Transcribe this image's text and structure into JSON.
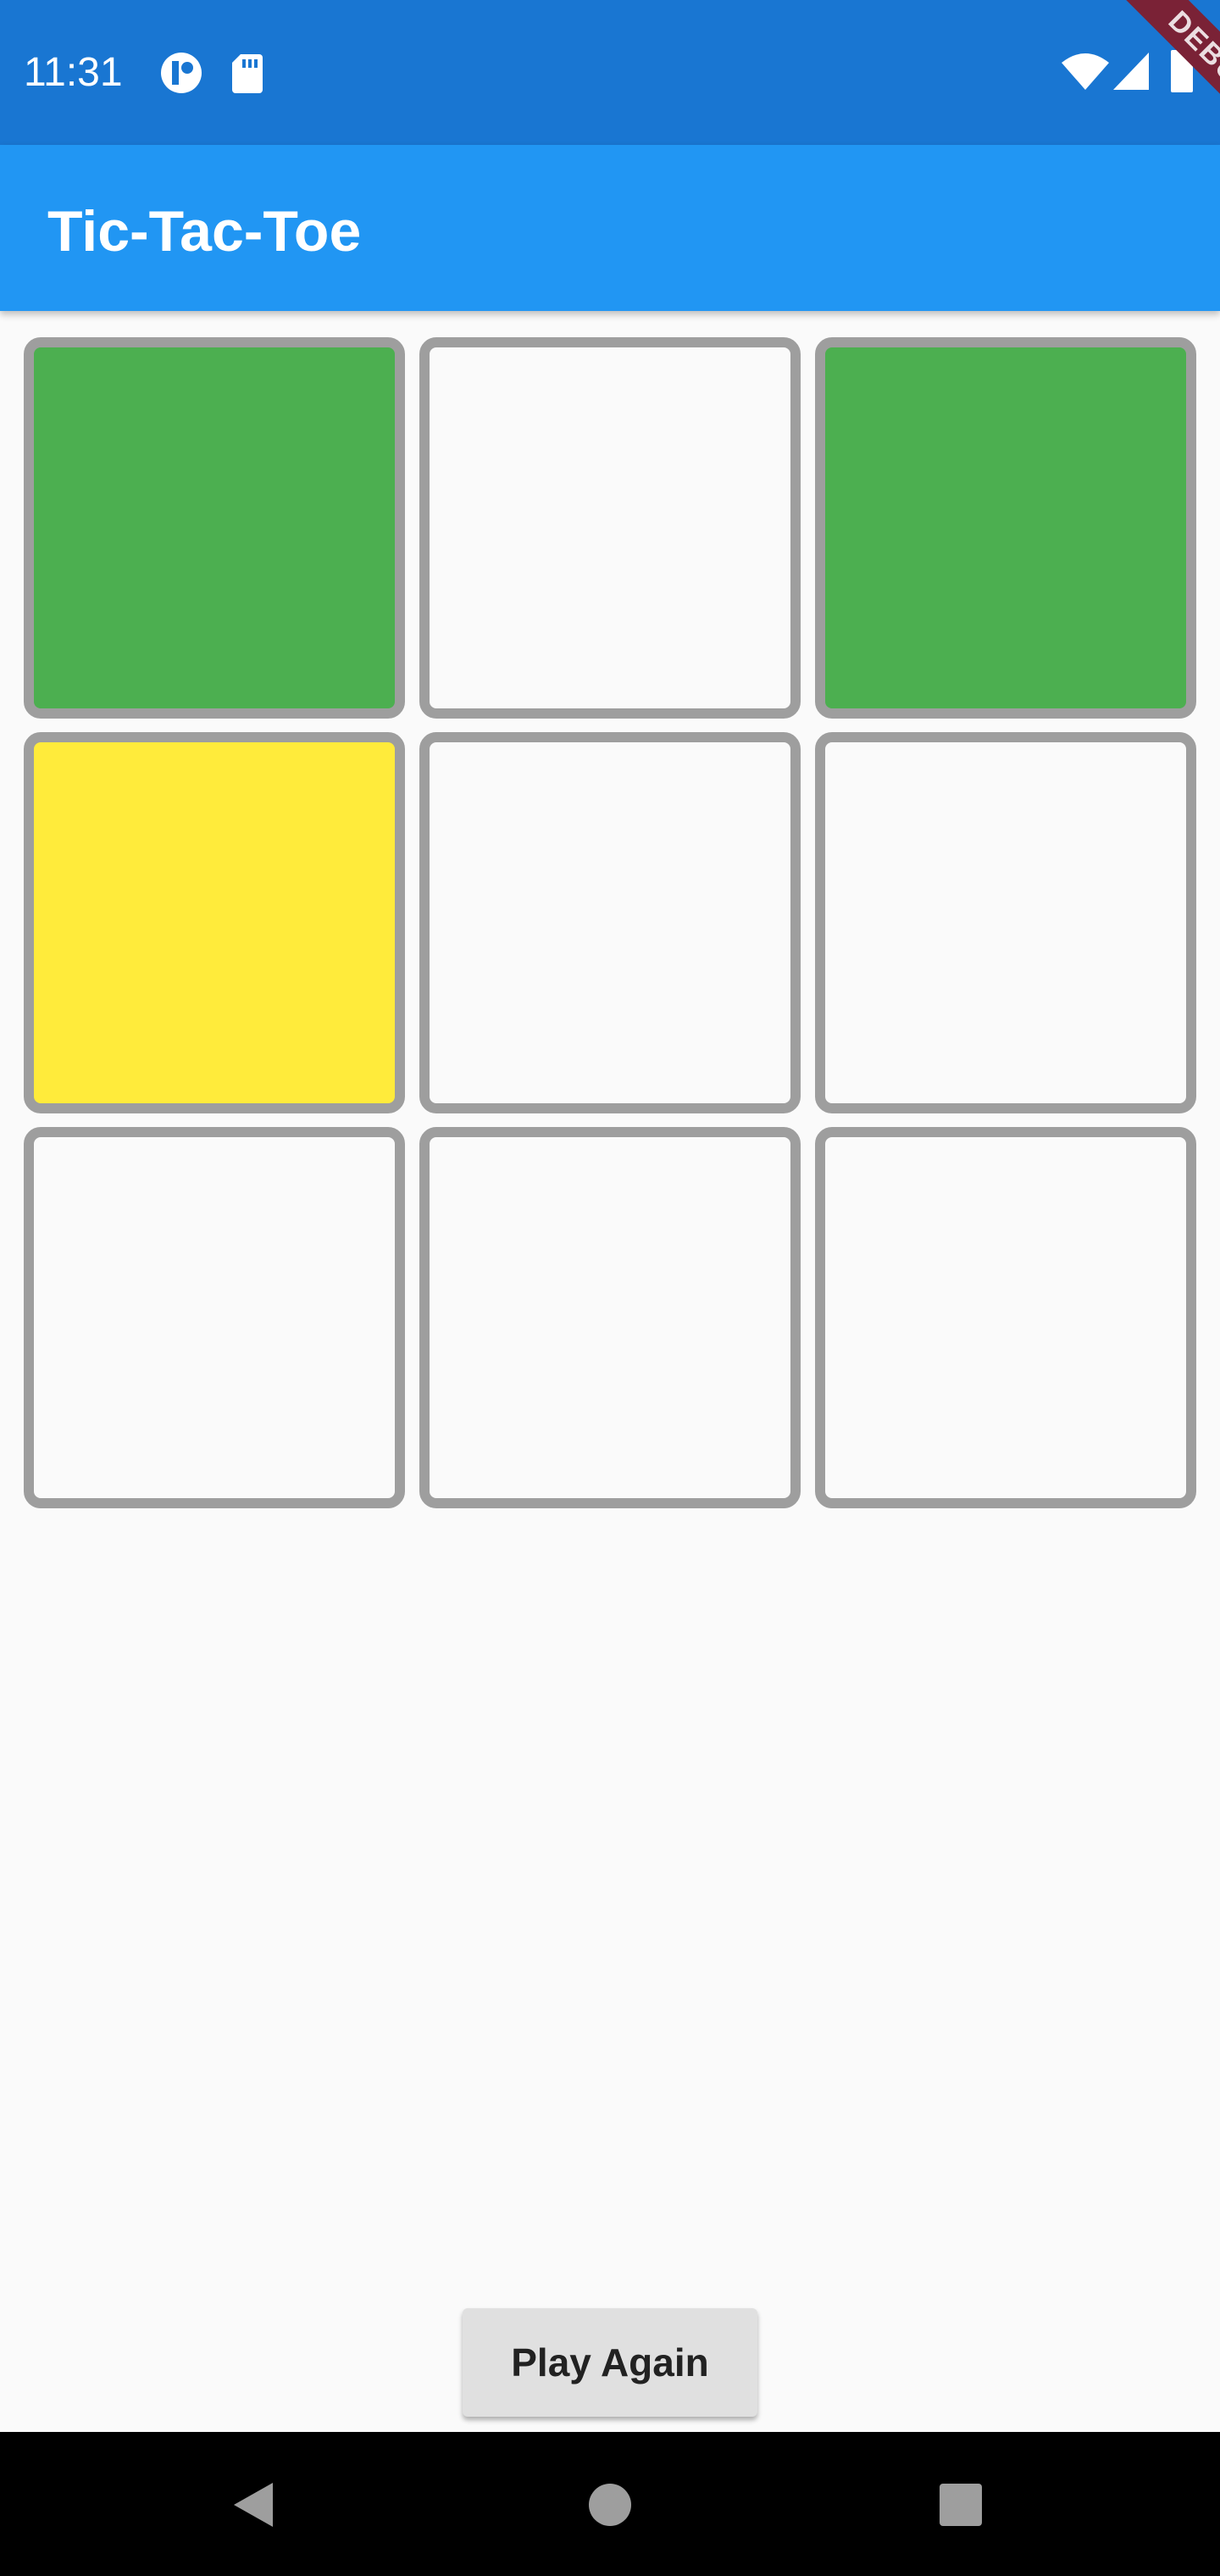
{
  "status_bar": {
    "time": "11:31",
    "icons": [
      "sync-icon",
      "sd-card-icon",
      "wifi-icon",
      "signal-icon",
      "battery-icon"
    ]
  },
  "debug_banner": {
    "label": "DEBUG"
  },
  "app_bar": {
    "title": "Tic-Tac-Toe"
  },
  "board": {
    "cells": [
      {
        "index": 0,
        "state": "green",
        "color": "#4caf50"
      },
      {
        "index": 1,
        "state": "empty",
        "color": "#fafafa"
      },
      {
        "index": 2,
        "state": "green",
        "color": "#4caf50"
      },
      {
        "index": 3,
        "state": "yellow",
        "color": "#ffeb3b"
      },
      {
        "index": 4,
        "state": "empty",
        "color": "#fafafa"
      },
      {
        "index": 5,
        "state": "empty",
        "color": "#fafafa"
      },
      {
        "index": 6,
        "state": "empty",
        "color": "#fafafa"
      },
      {
        "index": 7,
        "state": "empty",
        "color": "#fafafa"
      },
      {
        "index": 8,
        "state": "empty",
        "color": "#fafafa"
      }
    ],
    "border_color": "#9e9e9e"
  },
  "actions": {
    "play_again_label": "Play Again"
  },
  "colors": {
    "status_bar": "#1976d2",
    "app_bar": "#2196f3",
    "background": "#fafafa",
    "nav_bar": "#000000"
  },
  "nav_bar": {
    "icons": [
      "back-icon",
      "home-icon",
      "recents-icon"
    ]
  }
}
